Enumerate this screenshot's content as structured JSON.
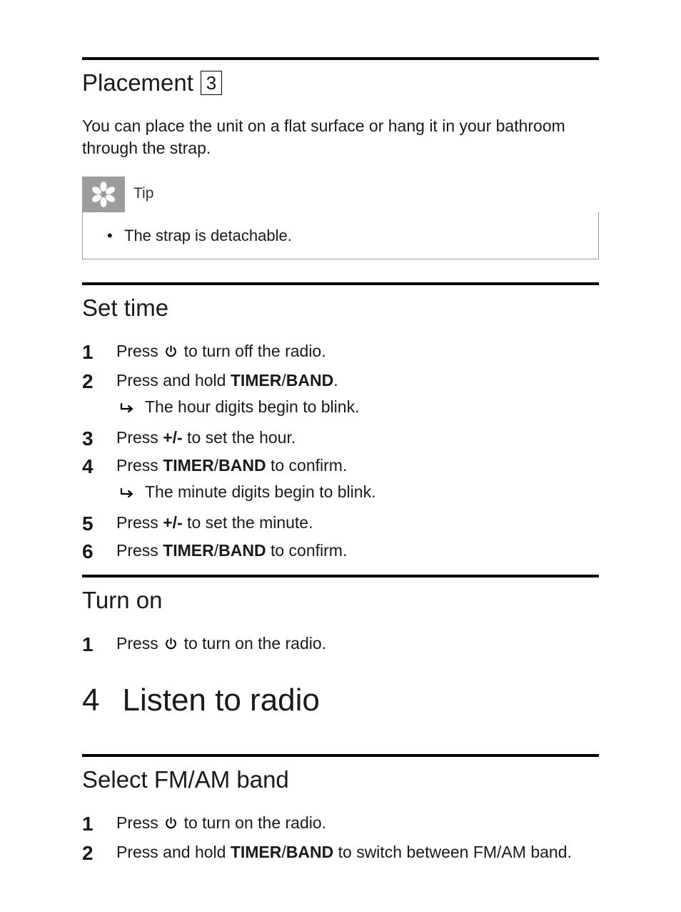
{
  "placement": {
    "heading": "Placement",
    "ref_num": "3",
    "body": "You can place the unit on a flat surface or hang it in your bathroom through the strap."
  },
  "tip": {
    "label": "Tip",
    "items": [
      "The strap is detachable."
    ]
  },
  "set_time": {
    "heading": "Set time",
    "steps": [
      {
        "pre": "Press ",
        "icon": "power",
        "post": " to turn off the radio."
      },
      {
        "pre": "Press and hold ",
        "bold": "TIMER",
        "sep": "/",
        "bold2": "BAND",
        "post": ".",
        "result": "The hour digits begin to blink."
      },
      {
        "pre": "Press ",
        "bold": "+/-",
        "post": " to set the hour."
      },
      {
        "pre": "Press ",
        "bold": "TIMER",
        "sep": "/",
        "bold2": "BAND",
        "post": " to confirm.",
        "result": "The minute digits begin to blink."
      },
      {
        "pre": "Press ",
        "bold": "+/-",
        "post": " to set the minute."
      },
      {
        "pre": "Press ",
        "bold": "TIMER",
        "sep": "/",
        "bold2": "BAND",
        "post": " to confirm."
      }
    ]
  },
  "turn_on": {
    "heading": "Turn on",
    "steps": [
      {
        "pre": "Press ",
        "icon": "power",
        "post": " to turn on the radio."
      }
    ]
  },
  "chapter": {
    "num": "4",
    "title": "Listen to radio"
  },
  "select_band": {
    "heading": "Select FM/AM band",
    "steps": [
      {
        "pre": "Press ",
        "icon": "power",
        "post": " to turn on the radio."
      },
      {
        "pre": "Press and hold ",
        "bold": "TIMER",
        "sep": "/",
        "bold2": "BAND",
        "post": " to switch between FM/AM band."
      }
    ]
  }
}
